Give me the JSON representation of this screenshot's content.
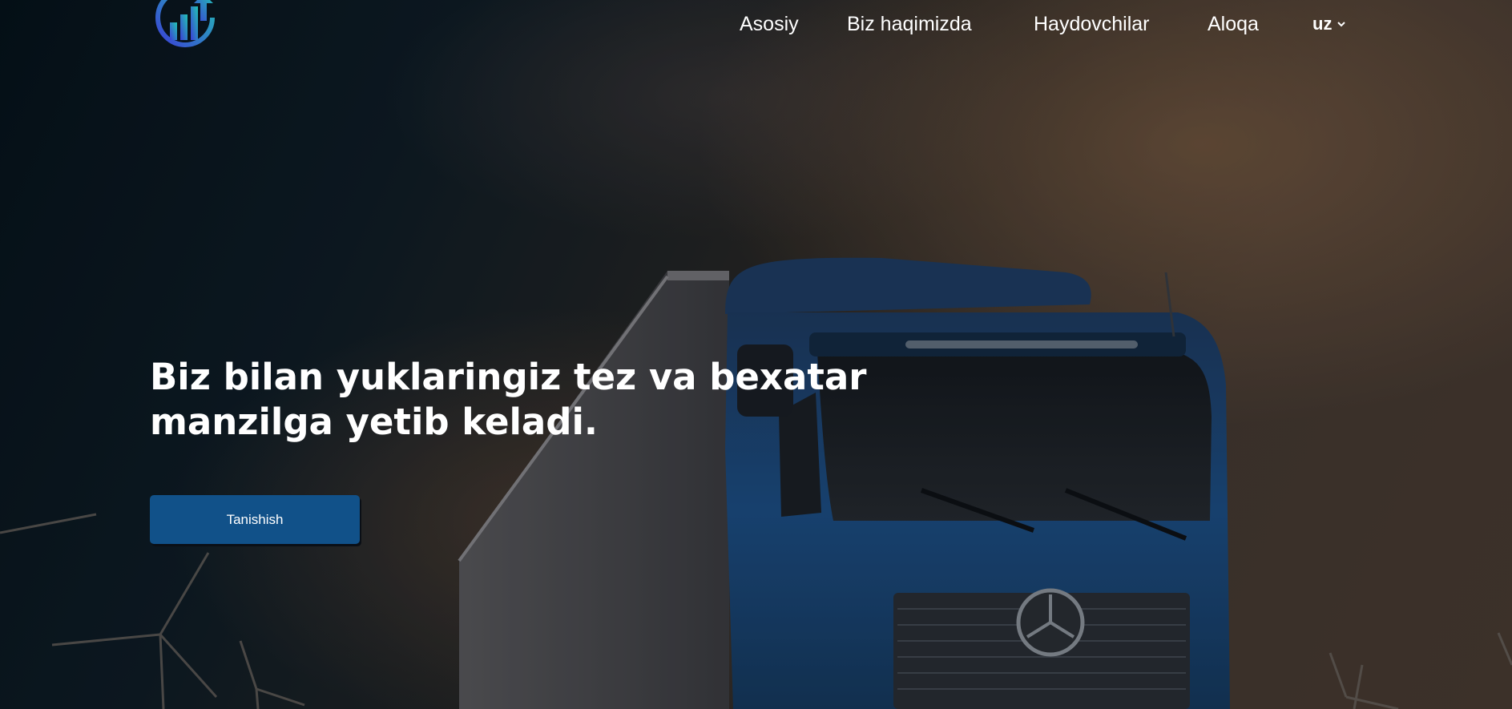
{
  "header": {
    "logo_icon": "growth-chart-logo-icon",
    "nav": [
      {
        "label": "Asosiy"
      },
      {
        "label": "Biz haqimizda"
      },
      {
        "label": "Haydovchilar"
      },
      {
        "label": "Aloqa"
      }
    ],
    "language": {
      "selected": "uz",
      "icon": "chevron-down-icon"
    }
  },
  "hero": {
    "headline_line1": "Biz bilan yuklaringiz tez va bexatar",
    "headline_line2": "manzilga yetib keladi.",
    "cta_label": "Tanishish"
  },
  "colors": {
    "cta_background": "#115189",
    "text": "#ffffff",
    "truck_cab": "#1d4f86",
    "logo_gradient_start": "#3b3fd6",
    "logo_gradient_end": "#22c3b4"
  }
}
